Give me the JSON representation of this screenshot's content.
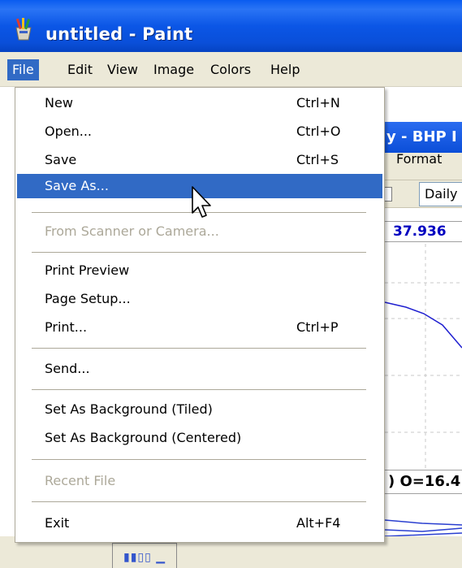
{
  "window": {
    "title": "untitled - Paint"
  },
  "menubar": {
    "items": [
      {
        "label": "File",
        "active": true
      },
      {
        "label": "Edit",
        "active": false
      },
      {
        "label": "View",
        "active": false
      },
      {
        "label": "Image",
        "active": false
      },
      {
        "label": "Colors",
        "active": false
      },
      {
        "label": "Help",
        "active": false
      }
    ]
  },
  "file_menu": {
    "items": [
      {
        "label": "New",
        "shortcut": "Ctrl+N",
        "enabled": true
      },
      {
        "label": "Open...",
        "shortcut": "Ctrl+O",
        "enabled": true
      },
      {
        "label": "Save",
        "shortcut": "Ctrl+S",
        "enabled": true
      },
      {
        "label": "Save As...",
        "shortcut": "",
        "enabled": true,
        "highlighted": true
      },
      {
        "label": "From Scanner or Camera...",
        "shortcut": "",
        "enabled": false
      },
      {
        "label": "Print Preview",
        "shortcut": "",
        "enabled": true
      },
      {
        "label": "Page Setup...",
        "shortcut": "",
        "enabled": true
      },
      {
        "label": "Print...",
        "shortcut": "Ctrl+P",
        "enabled": true
      },
      {
        "label": "Send...",
        "shortcut": "",
        "enabled": true
      },
      {
        "label": "Set As Background (Tiled)",
        "shortcut": "",
        "enabled": true
      },
      {
        "label": "Set As Background (Centered)",
        "shortcut": "",
        "enabled": true
      },
      {
        "label": "Recent File",
        "shortcut": "",
        "enabled": false
      },
      {
        "label": "Exit",
        "shortcut": "Alt+F4",
        "enabled": true
      }
    ]
  },
  "background_window": {
    "title_fragment": "y - BHP I",
    "menu_fragment": "Format",
    "period_select": "Daily",
    "value": "37.936",
    "ohlc_fragment": ") O=16.4"
  },
  "colors": {
    "menu_highlight": "#316ac5",
    "titlebar": "#0b56e6",
    "menubar_bg": "#ece9d8",
    "disabled_text": "#aca899",
    "value_text": "#0000c0"
  },
  "icons": {
    "app": "paint-brush-cup-icon",
    "cursor": "arrow-cursor-icon"
  }
}
